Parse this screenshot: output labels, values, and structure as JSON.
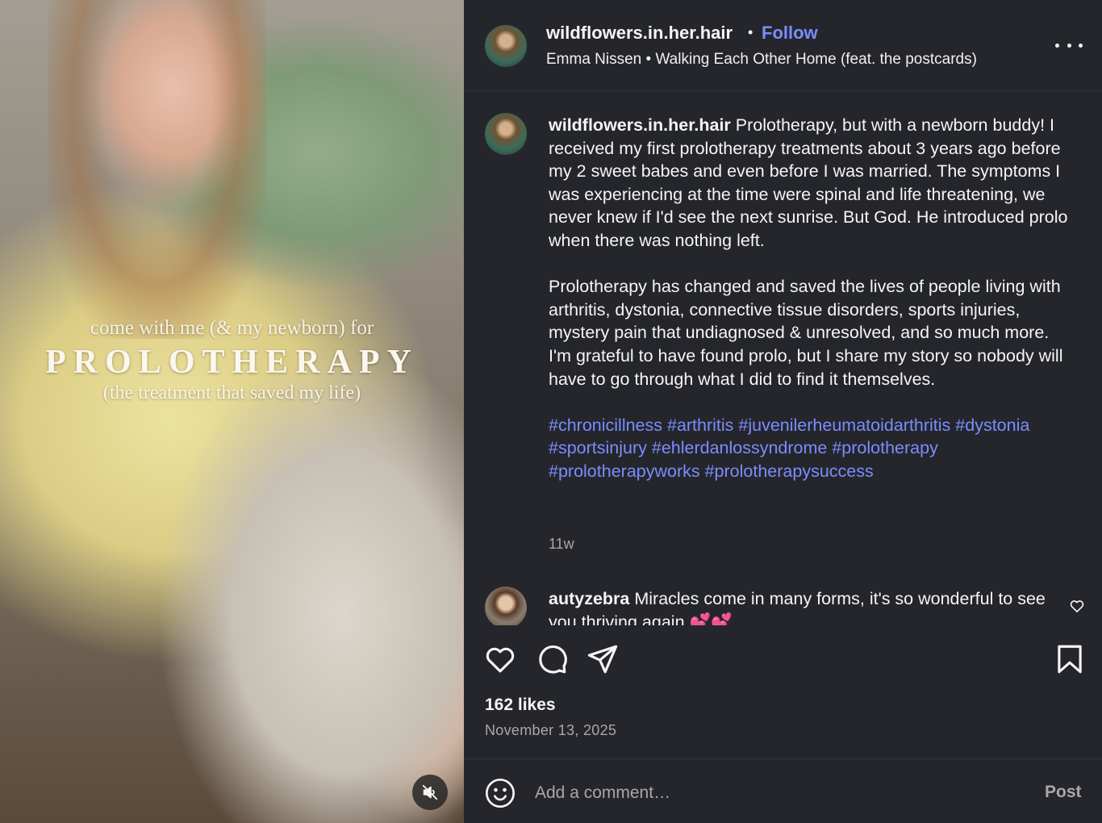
{
  "media": {
    "overlay": {
      "line1": "come with me (& my newborn) for",
      "line2": "PROLOTHERAPY",
      "line3": "(the treatment that saved my life)"
    },
    "mute_icon": "speaker-muted-icon"
  },
  "header": {
    "username": "wildflowers.in.her.hair",
    "separator": "•",
    "follow_label": "Follow",
    "audio": "Emma Nissen • Walking Each Other Home (feat. the postcards)",
    "more_icon": "more-horizontal-icon"
  },
  "caption": {
    "username": "wildflowers.in.her.hair",
    "paragraph1": " Prolotherapy, but with a newborn buddy! I received my first prolotherapy treatments about 3 years ago before my 2 sweet babes and even before I was married. The symptoms I was experiencing at the time were spinal and life threatening, we never knew if I'd see the next sunrise. But God. He introduced prolo when there was nothing left.",
    "paragraph2": "Prolotherapy has changed and saved the lives of people living with arthritis, dystonia, connective tissue disorders, sports injuries, mystery pain that undiagnosed & unresolved, and so much more. I'm grateful to have found prolo, but I share my story so nobody will have to go through what I did to find it themselves.",
    "hashtags": "#chronicillness #arthritis #juvenilerheumatoidarthritis #dystonia #sportsinjury #ehlerdanlossyndrome #prolotherapy #prolotherapyworks #prolotherapysuccess",
    "time_ago": "11w"
  },
  "comment": {
    "username": "autyzebra",
    "text": " Miracles come in many forms, it's so wonderful to see you thriving again 💕💕",
    "like_icon": "heart-outline-icon"
  },
  "actions": {
    "icons": [
      "heart-icon",
      "comment-icon",
      "share-icon",
      "bookmark-icon"
    ],
    "likes": "162 likes",
    "date": "November 13, 2025"
  },
  "comment_bar": {
    "emoji_icon": "emoji-smile-icon",
    "placeholder": "Add a comment…",
    "post_label": "Post"
  },
  "colors": {
    "panel_bg": "#25262b",
    "link_accent": "#7b8cff",
    "muted_text": "#a8a8a8"
  }
}
